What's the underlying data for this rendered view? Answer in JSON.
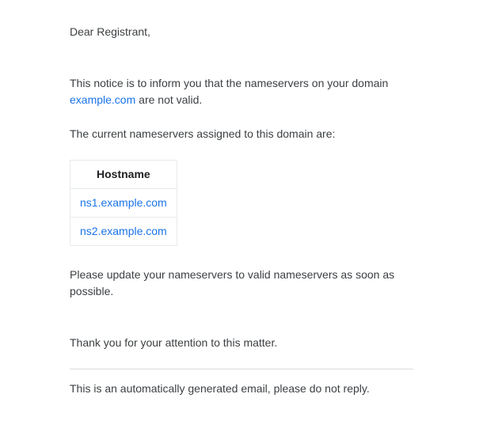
{
  "greeting": "Dear Registrant,",
  "intro_prefix": "This notice is to inform you that the nameservers on your domain ",
  "domain": "example.com",
  "intro_suffix": " are not valid.",
  "current_ns_label": "The current nameservers assigned to this domain are:",
  "table": {
    "header": "Hostname",
    "rows": [
      "ns1.example.com",
      "ns2.example.com"
    ]
  },
  "update_msg": "Please update your nameservers to valid nameservers as soon as possible.",
  "thank_you": "Thank you for your attention to this matter.",
  "footer": "This is an automatically generated email, please do not reply."
}
